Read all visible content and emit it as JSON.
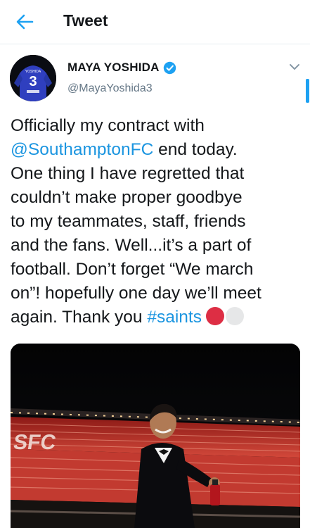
{
  "header": {
    "title": "Tweet",
    "back_icon": "arrow-left-icon",
    "accent": "#1da1f2"
  },
  "author": {
    "display_name": "MAYA YOSHIDA",
    "handle": "@MayaYoshida3",
    "verified": true,
    "avatar_jersey_name": "YOSHIDA",
    "avatar_jersey_number": "3"
  },
  "tweet": {
    "lines": [
      "Officially my contract with",
      "@SouthamptonFC",
      " end today.",
      "One thing I have regretted that",
      "couldn’t make proper goodbye",
      "to my teammates, staff, friends",
      "and the fans. Well...it’s a part of",
      "football. Don’t forget “We march",
      "on”! hopefully one day we’ll meet",
      "again. Thank you ",
      "#saints"
    ],
    "link_color": "#1b95e0",
    "emoji": [
      "red-circle",
      "white-circle"
    ]
  },
  "media": {
    "stand_text": "SFC",
    "description_icon": "photo"
  }
}
